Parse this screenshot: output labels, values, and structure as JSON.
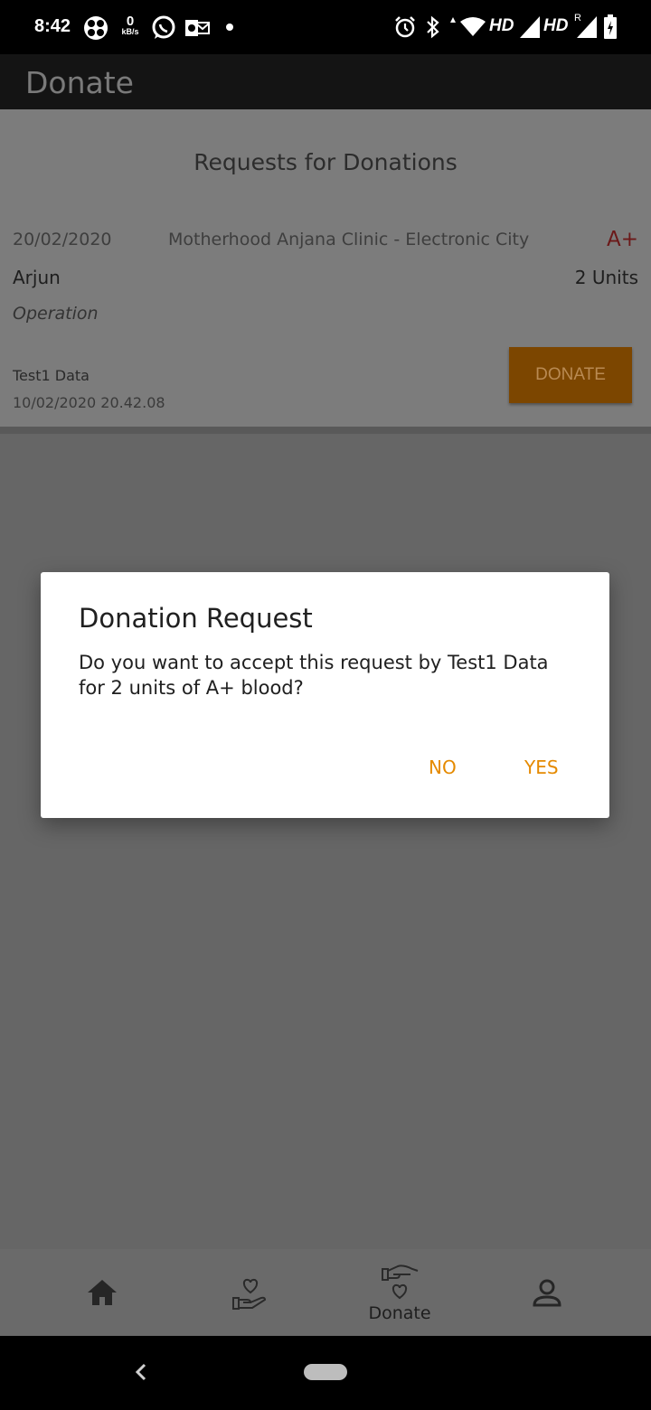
{
  "status_bar": {
    "time": "8:42",
    "speed_value": "0",
    "speed_unit": "kB/s",
    "network_hd_1": "HD",
    "network_hd_2": "HD",
    "roaming": "R",
    "icons": [
      "fan-icon",
      "whatsapp-icon",
      "outlook-icon",
      "alarm-icon",
      "bluetooth-icon",
      "wifi-icon",
      "signal-icon",
      "battery-icon"
    ]
  },
  "app_bar": {
    "title": "Donate"
  },
  "requests": {
    "heading": "Requests for Donations",
    "items": [
      {
        "date": "20/02/2020",
        "hospital": "Motherhood Anjana Clinic - Electronic City",
        "blood_group": "A+",
        "patient": "Arjun",
        "units": "2 Units",
        "reason": "Operation",
        "requester": "Test1 Data",
        "timestamp": "10/02/2020 20.42.08",
        "button_label": "DONATE"
      }
    ]
  },
  "dialog": {
    "title": "Donation Request",
    "message": "Do you want to accept this request by Test1 Data for 2 units of A+ blood?",
    "no_label": "NO",
    "yes_label": "YES"
  },
  "bottom_nav": {
    "items": [
      {
        "icon": "home-icon",
        "label": ""
      },
      {
        "icon": "hand-heart-icon",
        "label": ""
      },
      {
        "icon": "donate-icon",
        "label": "Donate"
      },
      {
        "icon": "profile-icon",
        "label": ""
      }
    ]
  },
  "colors": {
    "accent": "#e58a00",
    "blood_group": "#b02020",
    "dialog_bg": "#ffffff",
    "scrim": "#666666"
  }
}
